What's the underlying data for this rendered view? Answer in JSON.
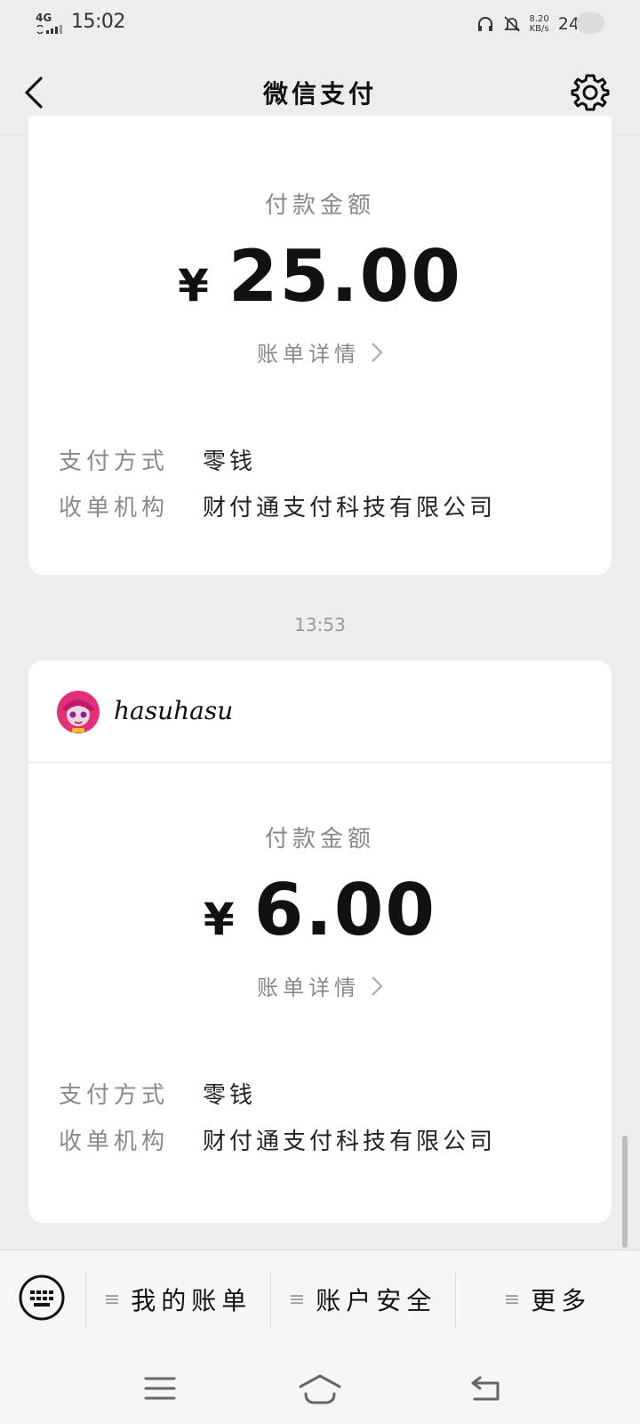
{
  "status_bar": {
    "network": "4G",
    "time": "15:02",
    "speed_value": "8.20",
    "speed_unit": "KB/s",
    "battery": "24%"
  },
  "nav": {
    "title": "微信支付"
  },
  "payments": [
    {
      "amount_label": "付款金额",
      "currency": "¥",
      "amount": "25.00",
      "detail_link": "账单详情",
      "method_key": "支付方式",
      "method_value": "零钱",
      "acquirer_key": "收单机构",
      "acquirer_value": "财付通支付科技有限公司"
    },
    {
      "merchant": "hasuhasu",
      "amount_label": "付款金额",
      "currency": "¥",
      "amount": "6.00",
      "detail_link": "账单详情",
      "method_key": "支付方式",
      "method_value": "零钱",
      "acquirer_key": "收单机构",
      "acquirer_value": "财付通支付科技有限公司"
    }
  ],
  "time_divider": "13:53",
  "bottom_menu": {
    "items": [
      {
        "label": "我的账单"
      },
      {
        "label": "账户安全"
      },
      {
        "label": "更多"
      }
    ],
    "lines_glyph": "≡"
  },
  "icons": {
    "back": "chevron-left-icon",
    "settings": "gear-icon",
    "keyboard": "keyboard-icon",
    "menu": "menu-icon",
    "home": "home-icon",
    "system_back": "back-arrow-icon"
  },
  "colors": {
    "background": "#ededed",
    "card": "#ffffff",
    "muted_text": "#888888",
    "primary_text": "#111111"
  }
}
